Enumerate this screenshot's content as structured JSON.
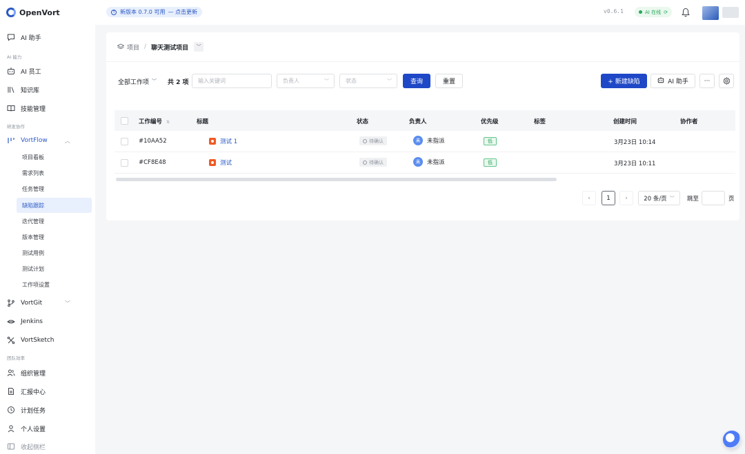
{
  "app": {
    "name": "OpenVort"
  },
  "topbar": {
    "update_text": "新版本 0.7.0 可用",
    "update_link": "— 点击更新",
    "version": "v0.6.1",
    "ai_status": "AI 在线"
  },
  "sidebar": {
    "ai_assistant": "AI 助手",
    "group_ai": "AI 能力",
    "ai_employee": "AI 员工",
    "knowledge": "知识库",
    "skills": "技能管理",
    "group_dev": "研发协作",
    "vortflow": "VortFlow",
    "vortflow_children": [
      "项目看板",
      "需求列表",
      "任务管理",
      "缺陷跟踪",
      "迭代管理",
      "版本管理",
      "测试用例",
      "测试计划",
      "工作项设置"
    ],
    "vortgit": "VortGit",
    "jenkins": "Jenkins",
    "vortsketch": "VortSketch",
    "group_team": "团队效率",
    "org": "组织管理",
    "reports": "汇报中心",
    "schedule": "计划任务",
    "personal": "个人设置",
    "collapse": "收起侧栏"
  },
  "breadcrumb": {
    "root": "项目",
    "current": "聊天测试项目"
  },
  "toolbar": {
    "type_select": "全部工作项",
    "count": "共 2 项",
    "keyword_placeholder": "输入关键词",
    "assignee_placeholder": "负责人",
    "status_placeholder": "状态",
    "query": "查询",
    "reset": "重置",
    "new_bug": "+ 新建缺陷",
    "ai_assistant": "AI 助手",
    "more": "···"
  },
  "table": {
    "columns": [
      "工作编号",
      "标题",
      "状态",
      "负责人",
      "优先级",
      "标签",
      "创建时间",
      "协作者"
    ],
    "rows": [
      {
        "id": "#10AA52",
        "title": "测试 1",
        "status": "待确认",
        "assignee_avatar": "未",
        "assignee": "未指派",
        "priority": "低",
        "tags": "",
        "created": "3月23日 10:14",
        "collaborators": ""
      },
      {
        "id": "#CF8E48",
        "title": "测试",
        "status": "待确认",
        "assignee_avatar": "未",
        "assignee": "未指派",
        "priority": "低",
        "tags": "",
        "created": "3月23日 10:11",
        "collaborators": ""
      }
    ]
  },
  "pagination": {
    "current": "1",
    "page_size": "20 条/页",
    "jump_label": "跳至",
    "page_label": "页"
  }
}
